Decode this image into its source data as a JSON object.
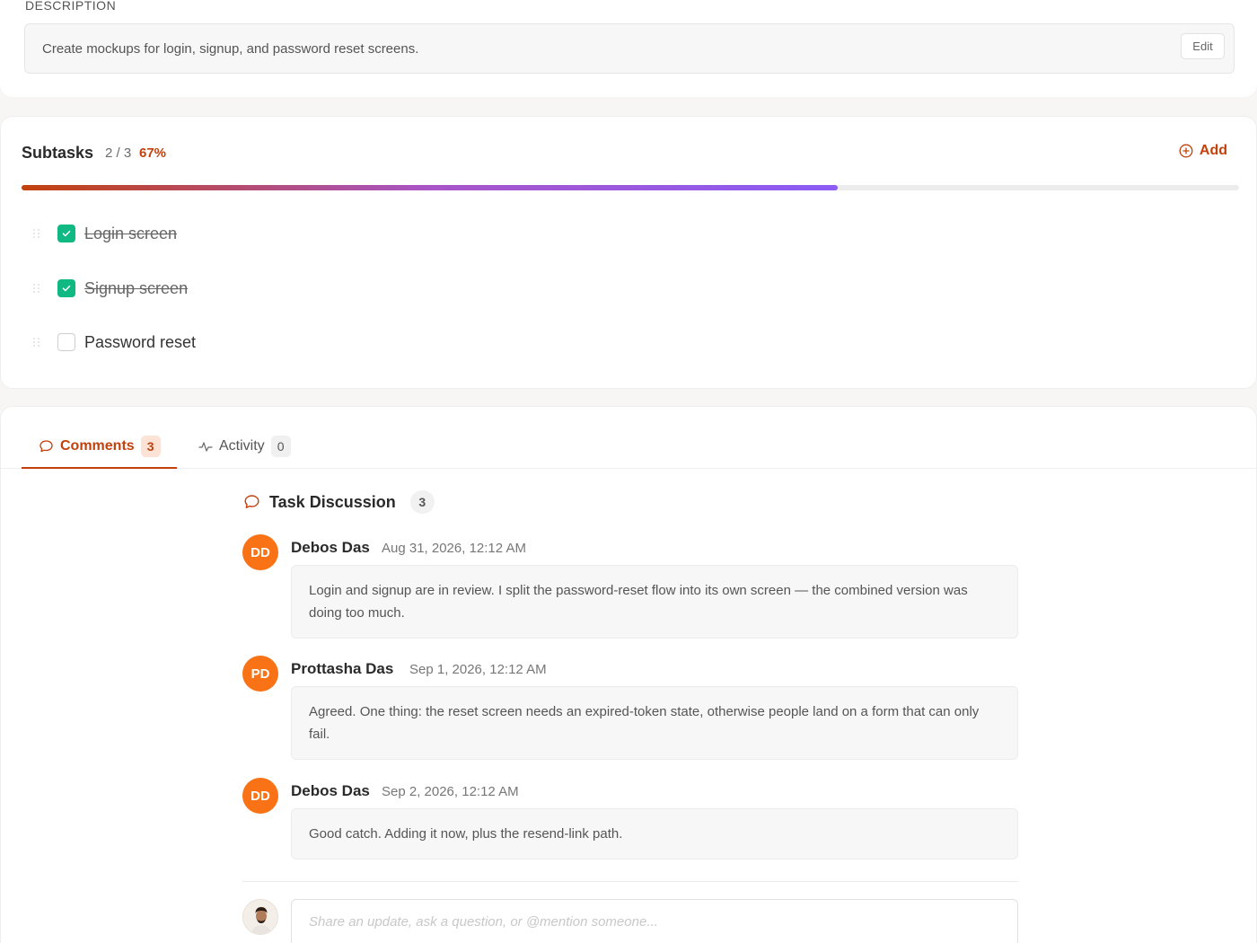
{
  "description": {
    "label": "DESCRIPTION",
    "text": "Create mockups for login, signup, and password reset screens.",
    "edit_label": "Edit"
  },
  "subtasks": {
    "title": "Subtasks",
    "count": "2 / 3",
    "percent": "67%",
    "progress_fraction": 0.67,
    "add_label": "Add",
    "items": [
      {
        "label": "Login screen",
        "done": true
      },
      {
        "label": "Signup screen",
        "done": true
      },
      {
        "label": "Password reset",
        "done": false
      }
    ]
  },
  "tabs": {
    "comments": {
      "label": "Comments",
      "count": "3"
    },
    "activity": {
      "label": "Activity",
      "count": "0"
    }
  },
  "discussion": {
    "title": "Task Discussion",
    "count": "3",
    "comments": [
      {
        "initials": "DD",
        "author": "Debos Das",
        "time": "Aug 31, 2026, 12:12 AM",
        "text": "Login and signup are in review. I split the password-reset flow into its own screen — the combined version was doing too much."
      },
      {
        "initials": "PD",
        "author": "Prottasha Das",
        "time": "Sep 1, 2026, 12:12 AM",
        "text": "Agreed. One thing: the reset screen needs an expired-token state, otherwise people land on a form that can only fail."
      },
      {
        "initials": "DD",
        "author": "Debos Das",
        "time": "Sep 2, 2026, 12:12 AM",
        "text": "Good catch. Adding it now, plus the resend-link path."
      }
    ],
    "reply_placeholder": "Share an update, ask a question, or @mention someone..."
  },
  "colors": {
    "accent": "#c2410c",
    "avatar": "#f97316",
    "check": "#10b981",
    "progress_end": "#8b5cf6"
  }
}
